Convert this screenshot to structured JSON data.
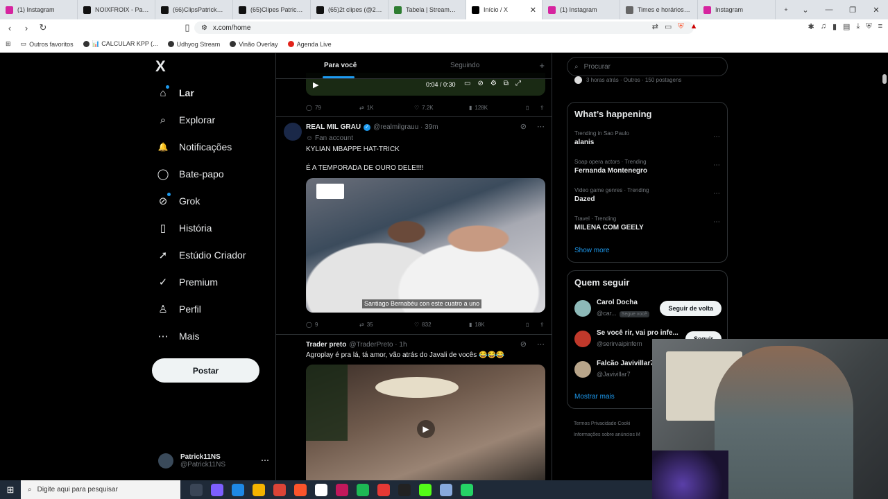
{
  "browser": {
    "tabs": [
      {
        "label": "(1) Instagram",
        "color": "#d6249f"
      },
      {
        "label": "NOIXFROIX - Patrick",
        "color": "#111111"
      },
      {
        "label": "(66)ClipsPatrickNs (@...",
        "color": "#111111"
      },
      {
        "label": "(65)Clipes Patrick11N...",
        "color": "#111111"
      },
      {
        "label": "(65)2t clipes (@2t.clip...",
        "color": "#111111"
      },
      {
        "label": "Tabela | Streammers",
        "color": "#2e7d32"
      },
      {
        "label": "Início / X",
        "color": "#000000",
        "active": true
      },
      {
        "label": "(1) Instagram",
        "color": "#d6249f"
      },
      {
        "label": "Times e horários dos...",
        "color": "#666666"
      },
      {
        "label": "Instagram",
        "color": "#d6249f"
      }
    ],
    "new_tab": "+",
    "window_controls": [
      "⌄",
      "—",
      "❐",
      "✕"
    ],
    "url": "x.com/home",
    "bookmarks": [
      "Outros favoritos",
      "📊 CALCULAR KPP (...",
      "Udhyog Stream",
      "Vinão Overlay",
      "Agenda Live"
    ]
  },
  "nav": {
    "logo": "X",
    "items": [
      {
        "label": "Lar",
        "icon": "home-icon",
        "glyph": "⌂"
      },
      {
        "label": "Explorar",
        "icon": "search-icon",
        "glyph": "⌕"
      },
      {
        "label": "Notificações",
        "icon": "bell-icon",
        "glyph": "🔔"
      },
      {
        "label": "Bate-papo",
        "icon": "chat-icon",
        "glyph": "◯"
      },
      {
        "label": "Grok",
        "icon": "grok-icon",
        "glyph": "⊘"
      },
      {
        "label": "História",
        "icon": "bookmark-icon",
        "glyph": "▯"
      },
      {
        "label": "Estúdio Criador",
        "icon": "rocket-icon",
        "glyph": "➚"
      },
      {
        "label": "Premium",
        "icon": "verified-icon",
        "glyph": "✓"
      },
      {
        "label": "Perfil",
        "icon": "person-icon",
        "glyph": "♙"
      },
      {
        "label": "Mais",
        "icon": "more-icon",
        "glyph": "⋯"
      }
    ],
    "post_button": "Postar",
    "account": {
      "name": "Patrick11NS",
      "handle": "@Patrick11NS"
    }
  },
  "feed": {
    "tabs": [
      "Para você",
      "Seguindo"
    ],
    "video_time": "0:04 / 0:30",
    "post0_actions": {
      "replies": "79",
      "reposts": "1K",
      "likes": "7.2K",
      "views": "128K"
    },
    "post1": {
      "name": "REAL MIL GRAU",
      "handle": "@realmilgrauu · 39m",
      "tag": "Fan account",
      "line1": "KYLIAN MBAPPE HAT-TRICK",
      "line2": "É A TEMPORADA DE OURO DELE!!!!",
      "caption": "Santiago Bernabéu con este cuatro a uno",
      "actions": {
        "replies": "9",
        "reposts": "35",
        "likes": "832",
        "views": "18K"
      }
    },
    "post2": {
      "name": "Trader preto",
      "handle": "@TraderPreto · 1h",
      "text": "Agroplay é pra lá, tá amor, vão atrás do Javali de vocês 😂😂😂"
    }
  },
  "right": {
    "search_placeholder": "Procurar",
    "top_snippet": "3 horas atrás · Outros · 150 postagens",
    "happening_title": "What’s happening",
    "trends": [
      {
        "context": "Trending in Sao Paulo",
        "topic": "alanis"
      },
      {
        "context": "Soap opera actors · Trending",
        "topic": "Fernanda Montenegro"
      },
      {
        "context": "Video game genres · Trending",
        "topic": "Dazed"
      },
      {
        "context": "Travel · Trending",
        "topic": "MILENA COM GEELY"
      }
    ],
    "show_more": "Show more",
    "who_title": "Quem seguir",
    "who": [
      {
        "name": "Carol Docha",
        "handle": "@car...",
        "badge": "Segue você",
        "button": "Seguir de volta"
      },
      {
        "name": "Se você rir, vai pro infe...",
        "handle": "@serirvaipinfern",
        "button": "Seguir"
      },
      {
        "name": "Falcão Javivillar7",
        "handle": "@Javivillar7"
      }
    ],
    "mostrar_mais": "Mostrar mais",
    "footer1": "Termos    Privacidade    Cooki",
    "footer2": "Informações sobre anúncios    M"
  },
  "taskbar": {
    "search_placeholder": "Digite aqui para pesquisar"
  },
  "colors": {
    "accent": "#1d9bf0",
    "bg": "#000000",
    "border": "#2f3336",
    "muted": "#71767b"
  }
}
